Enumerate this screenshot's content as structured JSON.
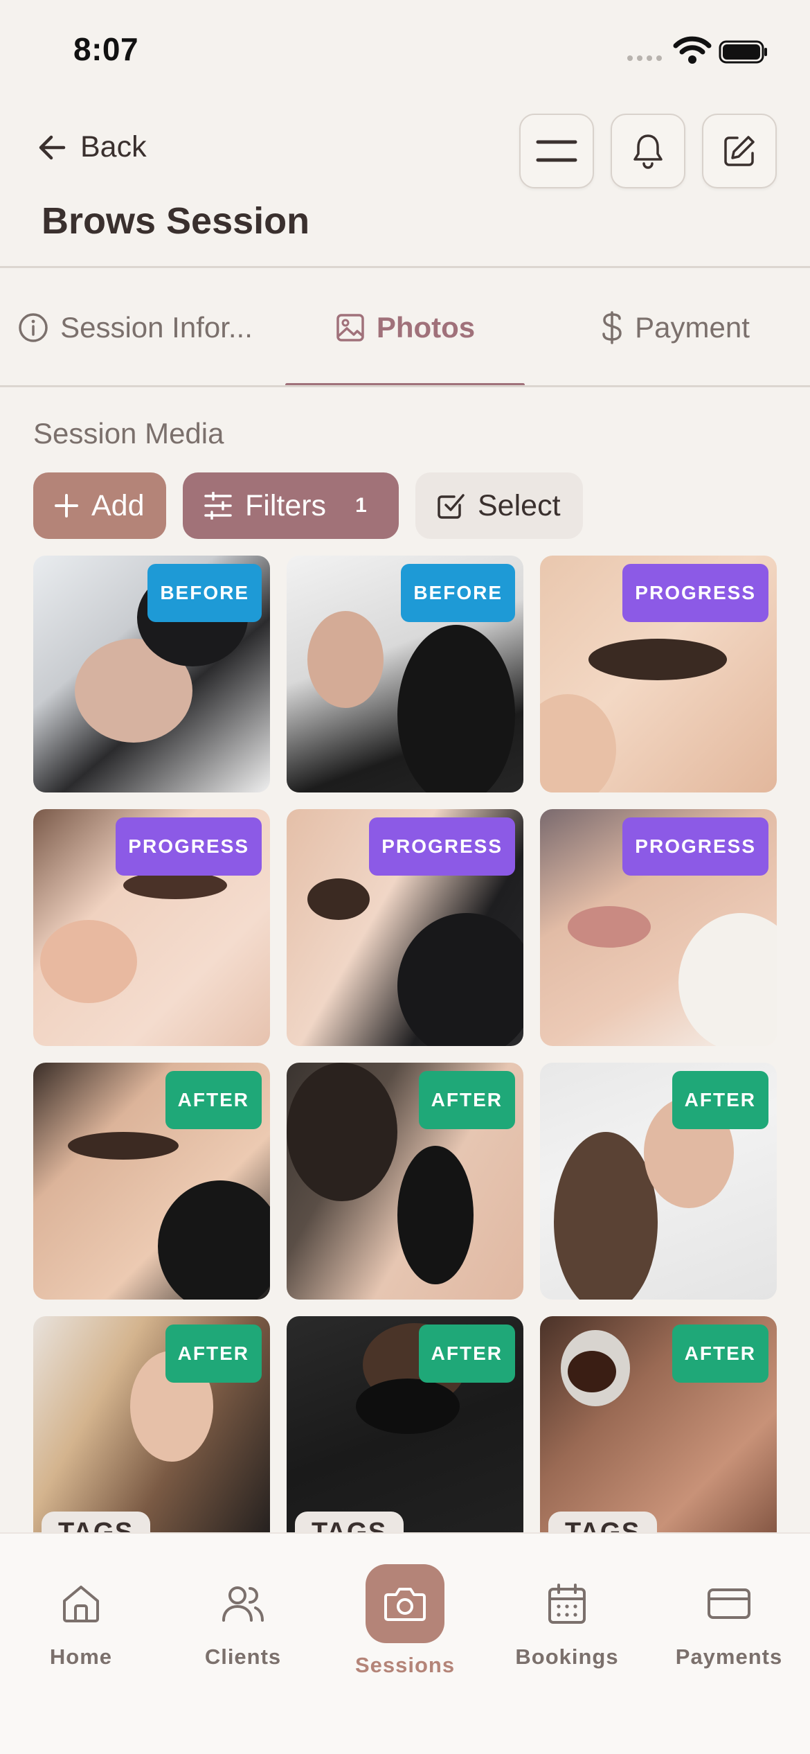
{
  "status_bar": {
    "time": "8:07"
  },
  "header": {
    "back_label": "Back",
    "title": "Brows Session"
  },
  "tabs": [
    {
      "label": "Session Infor...",
      "icon": "info-icon"
    },
    {
      "label": "Photos",
      "icon": "image-icon"
    },
    {
      "label": "Payment",
      "icon": "dollar-icon"
    }
  ],
  "media": {
    "section_title": "Session Media",
    "add_label": "Add",
    "filters_label": "Filters",
    "filters_count": "1",
    "select_label": "Select"
  },
  "photos": [
    {
      "badge": "BEFORE",
      "type": "before"
    },
    {
      "badge": "BEFORE",
      "type": "before"
    },
    {
      "badge": "PROGRESS",
      "type": "progress"
    },
    {
      "badge": "PROGRESS",
      "type": "progress"
    },
    {
      "badge": "PROGRESS",
      "type": "progress"
    },
    {
      "badge": "PROGRESS",
      "type": "progress"
    },
    {
      "badge": "AFTER",
      "type": "after"
    },
    {
      "badge": "AFTER",
      "type": "after"
    },
    {
      "badge": "AFTER",
      "type": "after"
    },
    {
      "badge": "AFTER",
      "type": "after",
      "tag": "TAGS"
    },
    {
      "badge": "AFTER",
      "type": "after",
      "tag": "TAGS"
    },
    {
      "badge": "AFTER",
      "type": "after",
      "tag": "TAGS"
    }
  ],
  "bottom_nav": [
    {
      "label": "Home",
      "icon": "home-icon"
    },
    {
      "label": "Clients",
      "icon": "users-icon"
    },
    {
      "label": "Sessions",
      "icon": "camera-icon"
    },
    {
      "label": "Bookings",
      "icon": "calendar-icon"
    },
    {
      "label": "Payments",
      "icon": "credit-card-icon"
    }
  ],
  "colors": {
    "background": "#f5f2ee",
    "accent": "#b48478",
    "accent_dark": "#a17278",
    "before_badge": "#1e9ad6",
    "progress_badge": "#8c5ae6",
    "after_badge": "#1fa878"
  }
}
